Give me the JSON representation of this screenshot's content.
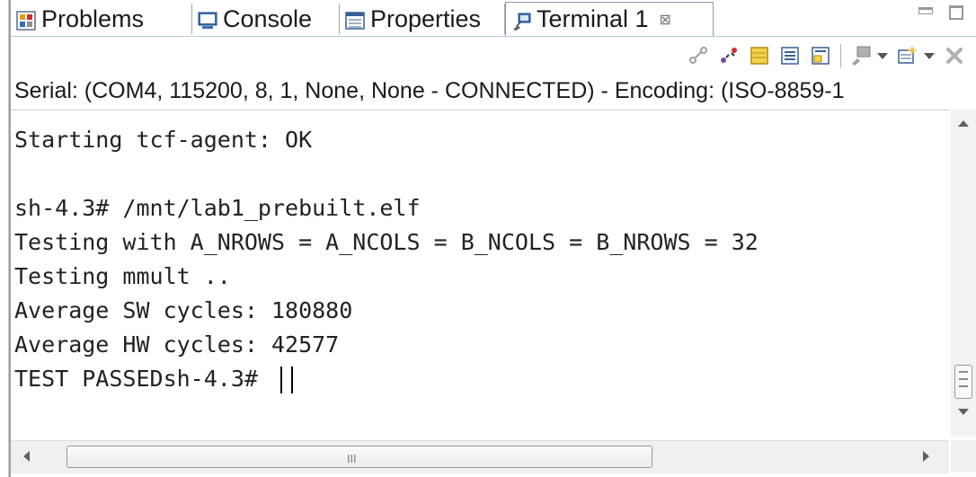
{
  "tabs": [
    {
      "label": "Problems",
      "icon": "problems-icon",
      "active": false
    },
    {
      "label": "Console",
      "icon": "console-icon",
      "active": false
    },
    {
      "label": "Properties",
      "icon": "properties-icon",
      "active": false
    },
    {
      "label": "Terminal 1",
      "icon": "terminal-icon",
      "active": true,
      "close": "⊠"
    }
  ],
  "toolbar": {
    "icons": [
      "connect-icon",
      "disconnect-icon",
      "settings-icon",
      "scroll-lock-icon",
      "command-input-icon",
      "display-selected-icon",
      "new-terminal-icon",
      "remove-icon"
    ]
  },
  "status": {
    "text": "Serial: (COM4, 115200, 8, 1, None, None - CONNECTED) - Encoding: (ISO-8859-1"
  },
  "terminal": {
    "lines": [
      "Starting tcf-agent: OK",
      "",
      "sh-4.3# /mnt/lab1_prebuilt.elf",
      "Testing with A_NROWS = A_NCOLS = B_NCOLS = B_NROWS = 32",
      "Testing mmult ..",
      "Average SW cycles: 180880",
      "Average HW cycles: 42577",
      "TEST PASSEDsh-4.3# "
    ]
  },
  "hscroll": {
    "grip": "III"
  },
  "colors": {
    "tab_border": "#8a9bb3",
    "background": "#ffffff",
    "scrollbar": "#f0f0f0"
  }
}
